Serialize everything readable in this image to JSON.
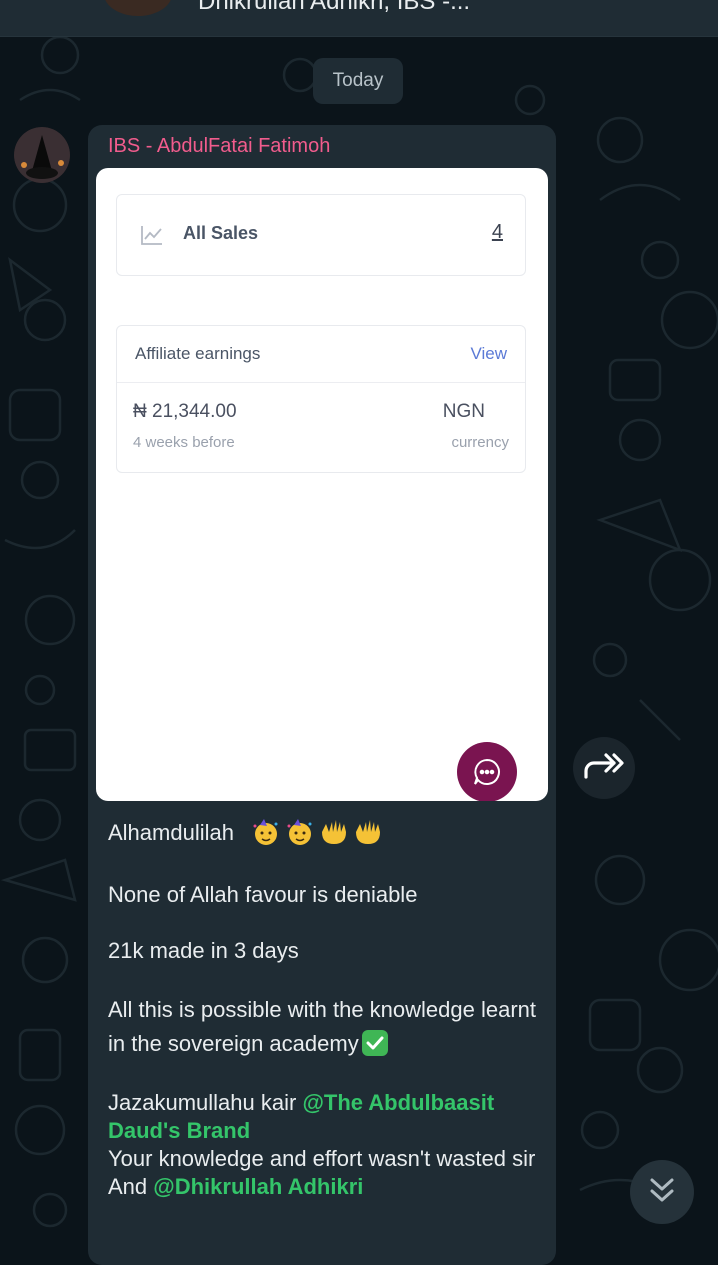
{
  "header": {
    "title": "Dhikrullah Adhikri, IBS -..."
  },
  "date_chip": "Today",
  "message": {
    "sender": "IBS - AbdulFatai Fatimoh",
    "image": {
      "sales_label": "All Sales",
      "sales_count": "4",
      "earnings_title": "Affiliate earnings",
      "earnings_link": "View",
      "amount": "₦ 21,344.00",
      "period": "4 weeks before",
      "currency_code": "NGN",
      "currency_label": "currency"
    },
    "line1": "Alhamdulilah",
    "line2": "None of Allah favour is deniable",
    "line3": "21k made in 3 days",
    "line4a": "All this is possible with the knowledge learnt in the sovereign academy",
    "line5a": "Jazakumullahu kair ",
    "mention1": "@The Abdulbaasit Daud's Brand",
    "line6": "Your knowledge and effort wasn't wasted sir",
    "line7a": "And ",
    "mention2": "@Dhikrullah Adhikri"
  },
  "colors": {
    "background": "#0b141a",
    "bubble": "#1f2c34",
    "sender_name": "#f15c8d",
    "mention": "#34c56a",
    "chat_fab": "#7a1450"
  }
}
